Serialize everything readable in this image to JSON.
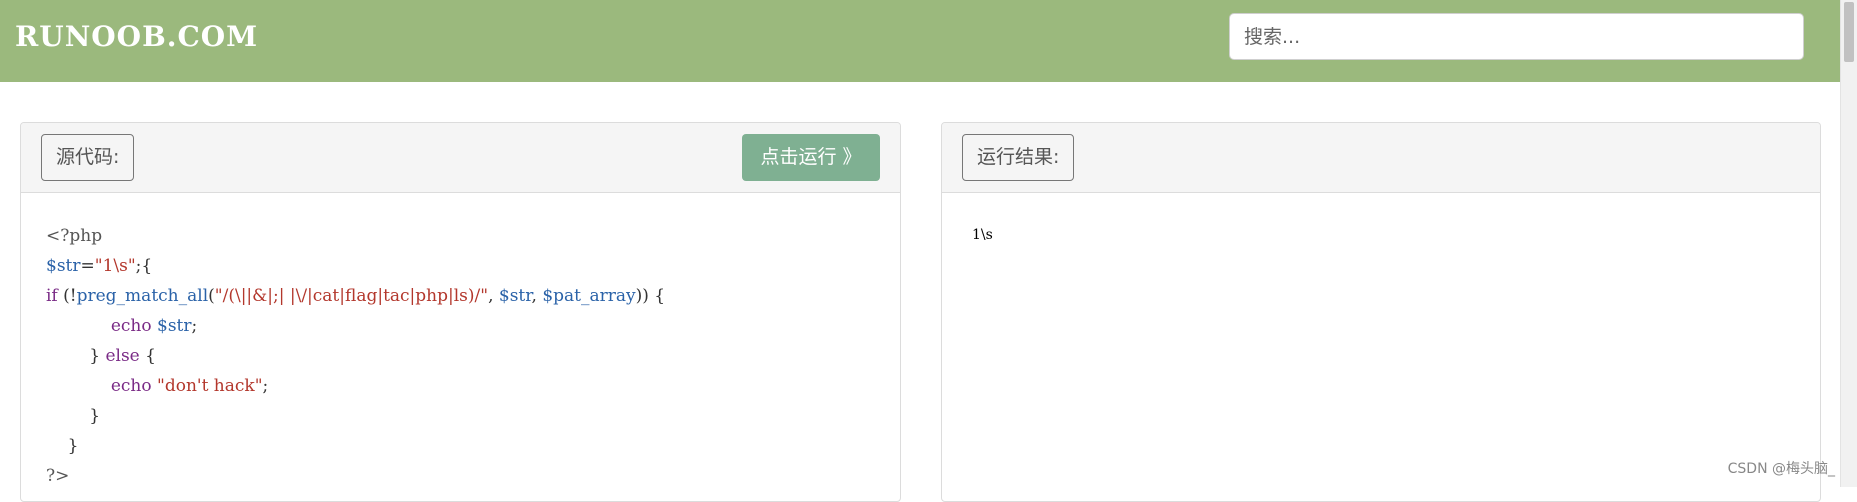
{
  "header": {
    "logo_text": "RUNOOB.COM",
    "search_placeholder": "搜索..."
  },
  "left_panel": {
    "label": "源代码:",
    "run_button": "点击运行 》",
    "code_lines": [
      [
        {
          "t": "<?php",
          "c": "php-tag"
        }
      ],
      [
        {
          "t": "$str",
          "c": "var"
        },
        {
          "t": "=",
          "c": "plain"
        },
        {
          "t": "\"1\\s\"",
          "c": "str"
        },
        {
          "t": ";{",
          "c": "plain"
        }
      ],
      [
        {
          "t": "if",
          "c": "kw"
        },
        {
          "t": " (!",
          "c": "plain"
        },
        {
          "t": "preg_match_all",
          "c": "fn"
        },
        {
          "t": "(",
          "c": "plain"
        },
        {
          "t": "\"/(\\||&|;| |\\/|cat|flag|tac|php|ls)/\"",
          "c": "str"
        },
        {
          "t": ", ",
          "c": "plain"
        },
        {
          "t": "$str",
          "c": "var"
        },
        {
          "t": ", ",
          "c": "plain"
        },
        {
          "t": "$pat_array",
          "c": "var"
        },
        {
          "t": ")) {",
          "c": "plain"
        }
      ],
      [
        {
          "t": "            echo ",
          "c": "kw"
        },
        {
          "t": "$str",
          "c": "var"
        },
        {
          "t": ";",
          "c": "plain"
        }
      ],
      [
        {
          "t": "        } ",
          "c": "plain"
        },
        {
          "t": "else",
          "c": "kw"
        },
        {
          "t": " {",
          "c": "plain"
        }
      ],
      [
        {
          "t": "            echo ",
          "c": "kw"
        },
        {
          "t": "\"don't hack\"",
          "c": "str"
        },
        {
          "t": ";",
          "c": "plain"
        }
      ],
      [
        {
          "t": "        }",
          "c": "plain"
        }
      ],
      [
        {
          "t": "    }",
          "c": "plain"
        }
      ],
      [
        {
          "t": "?>",
          "c": "php-tag"
        }
      ]
    ]
  },
  "right_panel": {
    "label": "运行结果:",
    "output": "1\\s"
  },
  "watermark": "CSDN @梅头脑_"
}
